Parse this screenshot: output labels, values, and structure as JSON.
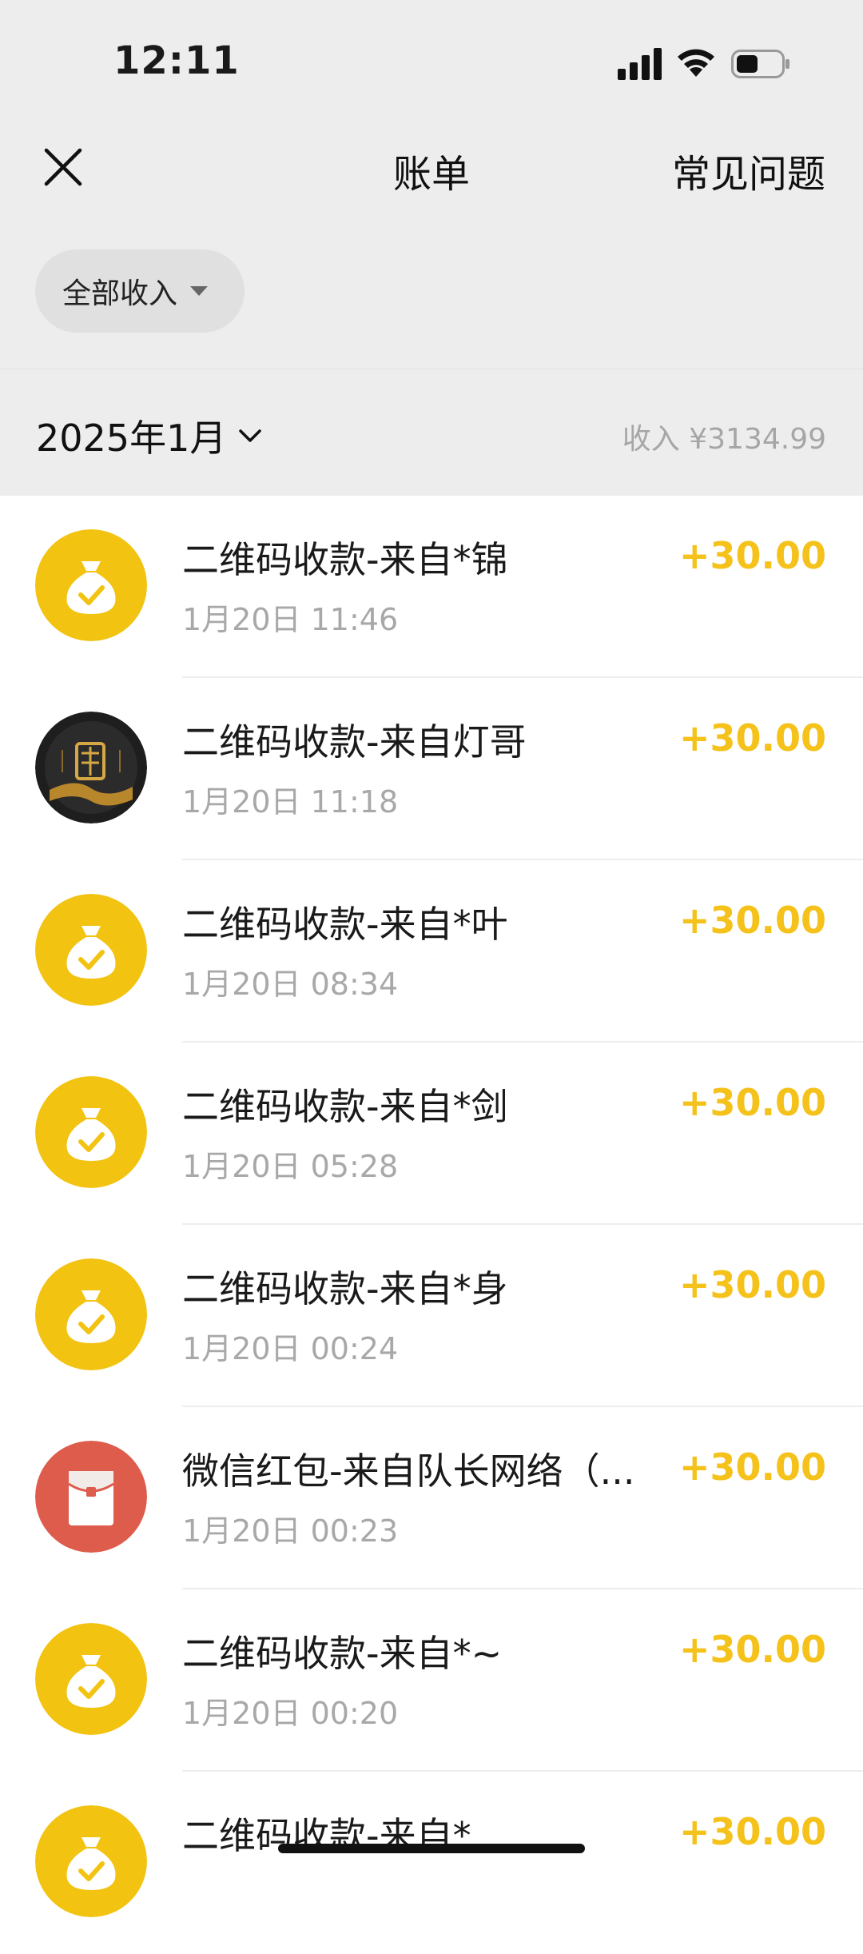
{
  "status_bar": {
    "time": "12:11"
  },
  "nav": {
    "title": "账单",
    "faq_label": "常见问题"
  },
  "filter": {
    "label": "全部收入"
  },
  "month": {
    "label": "2025年1月",
    "income_summary": "收入 ¥3134.99"
  },
  "colors": {
    "accent_amount": "#f5c21b",
    "icon_yellow": "#f2c311",
    "icon_red": "#de5c4c"
  },
  "transactions": [
    {
      "title": "二维码收款-来自*锦",
      "time": "1月20日 11:46",
      "amount": "+30.00",
      "icon": "money-bag-icon"
    },
    {
      "title": "二维码收款-来自灯哥",
      "time": "1月20日 11:18",
      "amount": "+30.00",
      "icon": "user-avatar"
    },
    {
      "title": "二维码收款-来自*叶",
      "time": "1月20日 08:34",
      "amount": "+30.00",
      "icon": "money-bag-icon"
    },
    {
      "title": "二维码收款-来自*剑",
      "time": "1月20日 05:28",
      "amount": "+30.00",
      "icon": "money-bag-icon"
    },
    {
      "title": "二维码收款-来自*身",
      "time": "1月20日 00:24",
      "amount": "+30.00",
      "icon": "money-bag-icon"
    },
    {
      "title": "微信红包-来自队长网络（...",
      "time": "1月20日 00:23",
      "amount": "+30.00",
      "icon": "red-packet-icon"
    },
    {
      "title": "二维码收款-来自*~",
      "time": "1月20日 00:20",
      "amount": "+30.00",
      "icon": "money-bag-icon"
    },
    {
      "title": "二维码收款-来自*",
      "time": "",
      "amount": "+30.00",
      "icon": "money-bag-icon"
    }
  ]
}
